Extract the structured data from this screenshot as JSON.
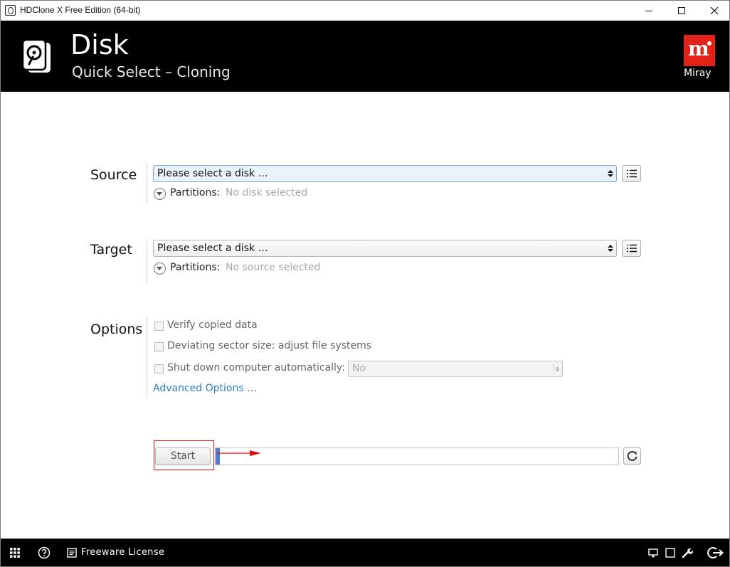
{
  "window": {
    "title": "HDClone X Free Edition (64-bit)"
  },
  "header": {
    "title": "Disk",
    "subtitle": "Quick Select – Cloning",
    "brand": "Miray",
    "brand_mark": "m"
  },
  "source": {
    "label": "Source",
    "select_value": "Please select a disk …",
    "partitions_label": "Partitions:",
    "partitions_value": "No disk selected"
  },
  "target": {
    "label": "Target",
    "select_value": "Please select a disk …",
    "partitions_label": "Partitions:",
    "partitions_value": "No source selected"
  },
  "options": {
    "label": "Options",
    "items": [
      {
        "label": "Verify copied data",
        "checked": false
      },
      {
        "label": "Deviating sector size: adjust file systems",
        "checked": false
      },
      {
        "label": "Shut down computer automatically:",
        "checked": false
      }
    ],
    "shutdown_select_value": "No",
    "advanced_link": "Advanced Options …"
  },
  "actions": {
    "start_label": "Start",
    "progress": 0.01
  },
  "footer": {
    "license_label": "Freeware License"
  },
  "colors": {
    "accent_red": "#e2231a",
    "link_blue": "#2b7cc6",
    "header_bg": "#000000",
    "progress_blue": "#4b7ecf"
  },
  "icons": [
    "app-icon",
    "minimize-icon",
    "maximize-icon",
    "close-icon",
    "disk-icon",
    "list-icon",
    "chevron-down-icon",
    "refresh-icon",
    "grid-icon",
    "help-icon",
    "license-icon",
    "monitor-icon",
    "window-icon",
    "wrench-icon",
    "exit-icon"
  ]
}
